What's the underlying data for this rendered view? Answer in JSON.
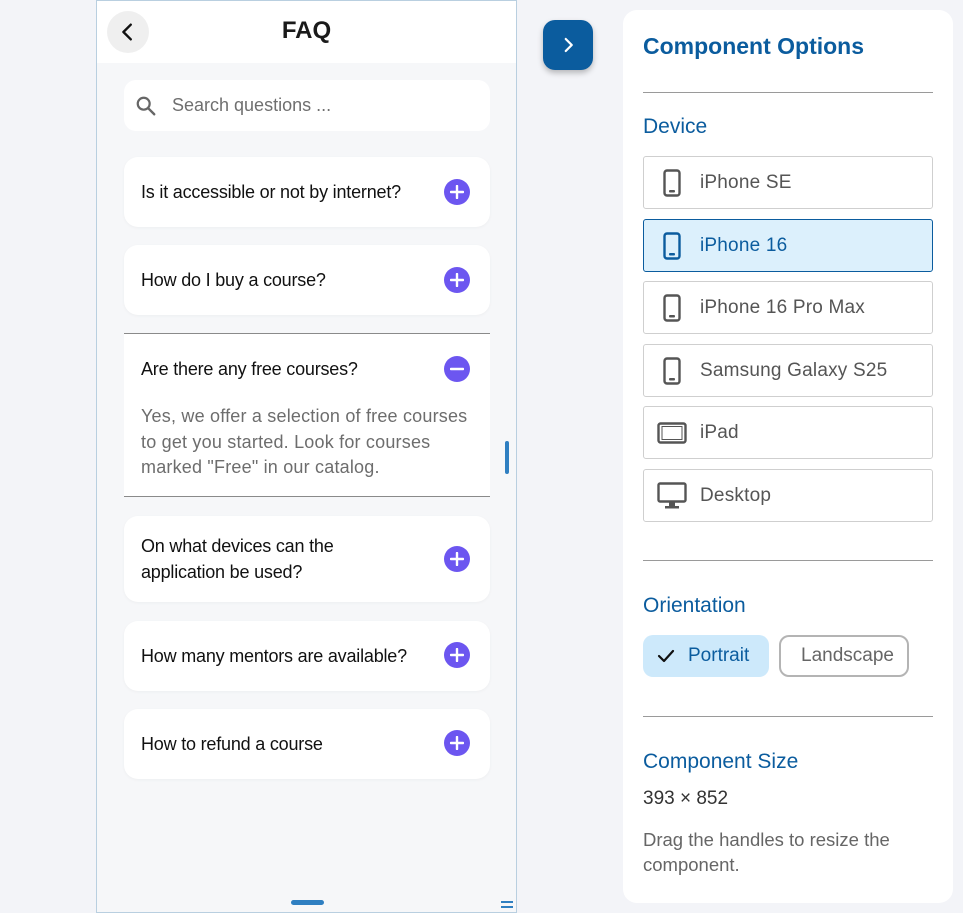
{
  "faq_app": {
    "title": "FAQ",
    "search": {
      "placeholder": "Search questions ...",
      "value": ""
    },
    "items": [
      {
        "question": "Is it accessible or not by internet?",
        "expanded": false
      },
      {
        "question": "How do I buy a course?",
        "expanded": false
      },
      {
        "question": "Are there any free courses?",
        "expanded": true,
        "answer": "Yes, we offer a selection of free courses to get you started. Look for courses marked \"Free\" in our catalog."
      },
      {
        "question": "On what devices can the application be used?",
        "expanded": false
      },
      {
        "question": "How many mentors are available?",
        "expanded": false
      },
      {
        "question": "How to refund a course",
        "expanded": false
      }
    ],
    "accent_color": "#6c56f0"
  },
  "options_panel": {
    "title": "Component Options",
    "device_label": "Device",
    "devices": [
      {
        "label": "iPhone SE",
        "icon": "phone-icon",
        "selected": false
      },
      {
        "label": "iPhone 16",
        "icon": "phone-icon",
        "selected": true
      },
      {
        "label": "iPhone 16 Pro Max",
        "icon": "phone-icon",
        "selected": false
      },
      {
        "label": "Samsung Galaxy S25",
        "icon": "phone-icon",
        "selected": false
      },
      {
        "label": "iPad",
        "icon": "tablet-icon",
        "selected": false
      },
      {
        "label": "Desktop",
        "icon": "monitor-icon",
        "selected": false
      }
    ],
    "orientation_label": "Orientation",
    "orientations": {
      "portrait": "Portrait",
      "landscape": "Landscape",
      "selected": "portrait"
    },
    "size_label": "Component Size",
    "size_value": "393 × 852",
    "size_hint": "Drag the handles to resize the component.",
    "accent_color": "#0b5c9e"
  }
}
